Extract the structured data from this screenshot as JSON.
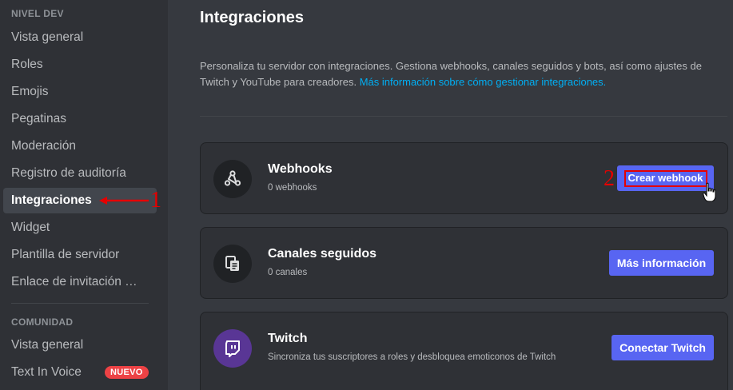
{
  "sidebar": {
    "sections": [
      {
        "header": "NIVEL DEV",
        "items": [
          {
            "label": "Vista general"
          },
          {
            "label": "Roles"
          },
          {
            "label": "Emojis"
          },
          {
            "label": "Pegatinas"
          },
          {
            "label": "Moderación"
          },
          {
            "label": "Registro de auditoría"
          },
          {
            "label": "Integraciones"
          },
          {
            "label": "Widget"
          },
          {
            "label": "Plantilla de servidor"
          },
          {
            "label": "Enlace de invitación personalizado"
          }
        ]
      },
      {
        "header": "COMUNIDAD",
        "items": [
          {
            "label": "Vista general"
          },
          {
            "label": "Text In Voice",
            "badge": "NUEVO"
          }
        ]
      }
    ],
    "active_item": "Integraciones"
  },
  "annotations": {
    "step1": "1",
    "step2": "2"
  },
  "main": {
    "title": "Integraciones",
    "description": "Personaliza tu servidor con integraciones. Gestiona webhooks, canales seguidos y bots, así como ajustes de Twitch y YouTube para creadores.",
    "description_link": "Más información sobre cómo gestionar integraciones.",
    "cards": [
      {
        "title": "Webhooks",
        "subtitle": "0 webhooks",
        "button": "Crear webhook",
        "icon": "webhook-icon"
      },
      {
        "title": "Canales seguidos",
        "subtitle": "0 canales",
        "button": "Más información",
        "icon": "followed-channel-icon"
      },
      {
        "title": "Twitch",
        "subtitle": "Sincroniza tus suscriptores a roles y desbloquea emoticonos de Twitch",
        "button": "Conectar Twitch",
        "icon": "twitch-icon"
      }
    ]
  },
  "colors": {
    "background": "#36393f",
    "sidebar": "#2f3136",
    "accent": "#5865f2",
    "link": "#00aff4",
    "badge": "#ed4245",
    "annotation": "#e60000",
    "twitch": "#593695"
  }
}
